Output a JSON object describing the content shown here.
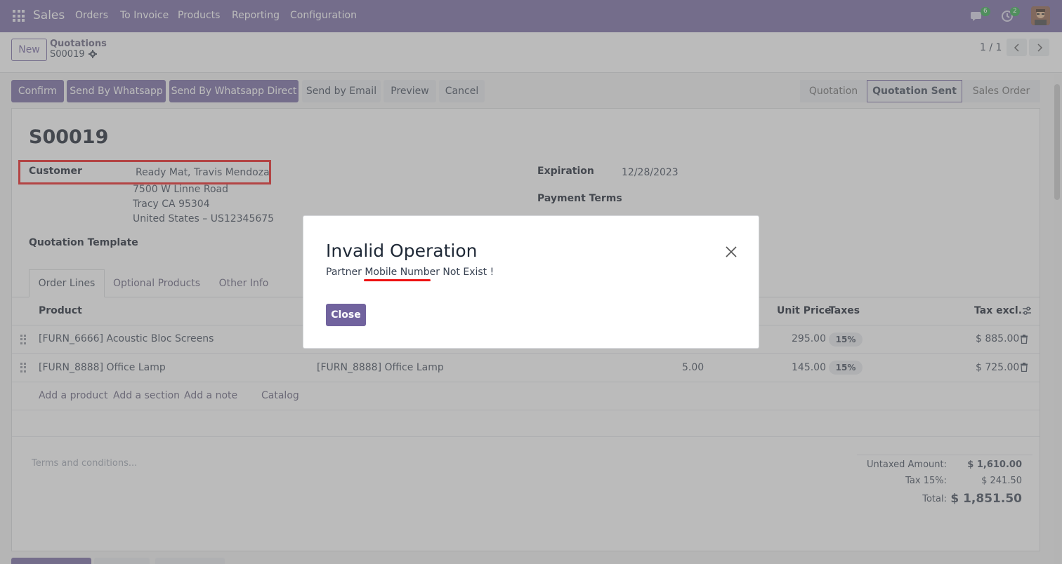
{
  "navbar": {
    "brand": "Sales",
    "menu": [
      "Orders",
      "To Invoice",
      "Products",
      "Reporting",
      "Configuration"
    ],
    "messages_count": "6",
    "activities_count": "2"
  },
  "control_panel": {
    "new_label": "New",
    "breadcrumb_parent": "Quotations",
    "breadcrumb_current": "S00019",
    "pager_value": "1 / 1"
  },
  "actions": {
    "confirm": "Confirm",
    "send_whatsapp": "Send By Whatsapp",
    "send_whatsapp_direct": "Send By Whatsapp Direct",
    "send_email": "Send by Email",
    "preview": "Preview",
    "cancel": "Cancel"
  },
  "status_steps": [
    "Quotation",
    "Quotation Sent",
    "Sales Order"
  ],
  "status_active": "Quotation Sent",
  "form": {
    "name": "S00019",
    "customer_label": "Customer",
    "customer_name": "Ready Mat, Travis Mendoza",
    "address_line1": "7500 W Linne Road",
    "address_line2": "Tracy CA 95304",
    "address_line3": "United States – US12345675",
    "template_label": "Quotation Template",
    "expiration_label": "Expiration",
    "expiration_value": "12/28/2023",
    "payment_terms_label": "Payment Terms"
  },
  "tabs": [
    "Order Lines",
    "Optional Products",
    "Other Info"
  ],
  "table": {
    "headers": {
      "product": "Product",
      "unit_price": "Unit Price",
      "taxes": "Taxes",
      "tax_excl": "Tax excl."
    },
    "rows": [
      {
        "product": "[FURN_6666] Acoustic Bloc Screens",
        "description": "",
        "quantity": "",
        "unit_price": "295.00",
        "tax": "15%",
        "subtotal": "$ 885.00"
      },
      {
        "product": "[FURN_8888] Office Lamp",
        "description": "[FURN_8888] Office Lamp",
        "quantity": "5.00",
        "unit_price": "145.00",
        "tax": "15%",
        "subtotal": "$ 725.00"
      }
    ],
    "add_product": "Add a product",
    "add_section": "Add a section",
    "add_note": "Add a note",
    "catalog": "Catalog"
  },
  "terms_placeholder": "Terms and conditions...",
  "totals": {
    "untaxed_label": "Untaxed Amount:",
    "untaxed_value": "$ 1,610.00",
    "tax_label": "Tax 15%:",
    "tax_value": "$ 241.50",
    "total_label": "Total:",
    "total_value": "$ 1,851.50"
  },
  "modal": {
    "title": "Invalid Operation",
    "message": "Partner Mobile Number Not Exist !",
    "close_label": "Close"
  },
  "colors": {
    "brand": "#71639e",
    "highlight": "#ee1111",
    "badge_green": "#28a745"
  }
}
